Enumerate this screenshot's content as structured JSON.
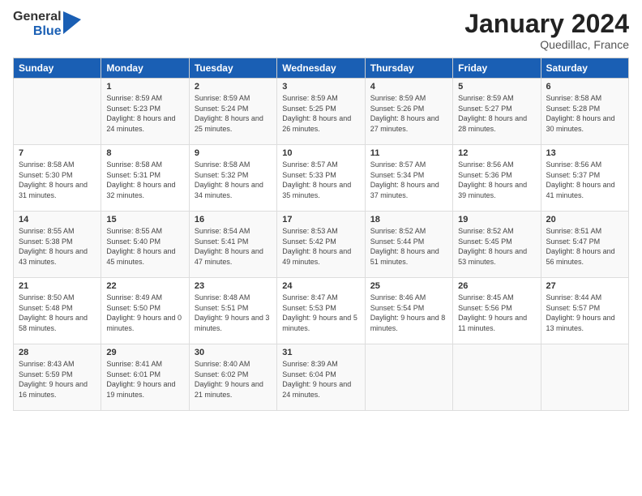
{
  "header": {
    "logo_general": "General",
    "logo_blue": "Blue",
    "month_title": "January 2024",
    "location": "Quedillac, France"
  },
  "days_of_week": [
    "Sunday",
    "Monday",
    "Tuesday",
    "Wednesday",
    "Thursday",
    "Friday",
    "Saturday"
  ],
  "weeks": [
    [
      {
        "day": "",
        "sunrise": "",
        "sunset": "",
        "daylight": ""
      },
      {
        "day": "1",
        "sunrise": "Sunrise: 8:59 AM",
        "sunset": "Sunset: 5:23 PM",
        "daylight": "Daylight: 8 hours and 24 minutes."
      },
      {
        "day": "2",
        "sunrise": "Sunrise: 8:59 AM",
        "sunset": "Sunset: 5:24 PM",
        "daylight": "Daylight: 8 hours and 25 minutes."
      },
      {
        "day": "3",
        "sunrise": "Sunrise: 8:59 AM",
        "sunset": "Sunset: 5:25 PM",
        "daylight": "Daylight: 8 hours and 26 minutes."
      },
      {
        "day": "4",
        "sunrise": "Sunrise: 8:59 AM",
        "sunset": "Sunset: 5:26 PM",
        "daylight": "Daylight: 8 hours and 27 minutes."
      },
      {
        "day": "5",
        "sunrise": "Sunrise: 8:59 AM",
        "sunset": "Sunset: 5:27 PM",
        "daylight": "Daylight: 8 hours and 28 minutes."
      },
      {
        "day": "6",
        "sunrise": "Sunrise: 8:58 AM",
        "sunset": "Sunset: 5:28 PM",
        "daylight": "Daylight: 8 hours and 30 minutes."
      }
    ],
    [
      {
        "day": "7",
        "sunrise": "Sunrise: 8:58 AM",
        "sunset": "Sunset: 5:30 PM",
        "daylight": "Daylight: 8 hours and 31 minutes."
      },
      {
        "day": "8",
        "sunrise": "Sunrise: 8:58 AM",
        "sunset": "Sunset: 5:31 PM",
        "daylight": "Daylight: 8 hours and 32 minutes."
      },
      {
        "day": "9",
        "sunrise": "Sunrise: 8:58 AM",
        "sunset": "Sunset: 5:32 PM",
        "daylight": "Daylight: 8 hours and 34 minutes."
      },
      {
        "day": "10",
        "sunrise": "Sunrise: 8:57 AM",
        "sunset": "Sunset: 5:33 PM",
        "daylight": "Daylight: 8 hours and 35 minutes."
      },
      {
        "day": "11",
        "sunrise": "Sunrise: 8:57 AM",
        "sunset": "Sunset: 5:34 PM",
        "daylight": "Daylight: 8 hours and 37 minutes."
      },
      {
        "day": "12",
        "sunrise": "Sunrise: 8:56 AM",
        "sunset": "Sunset: 5:36 PM",
        "daylight": "Daylight: 8 hours and 39 minutes."
      },
      {
        "day": "13",
        "sunrise": "Sunrise: 8:56 AM",
        "sunset": "Sunset: 5:37 PM",
        "daylight": "Daylight: 8 hours and 41 minutes."
      }
    ],
    [
      {
        "day": "14",
        "sunrise": "Sunrise: 8:55 AM",
        "sunset": "Sunset: 5:38 PM",
        "daylight": "Daylight: 8 hours and 43 minutes."
      },
      {
        "day": "15",
        "sunrise": "Sunrise: 8:55 AM",
        "sunset": "Sunset: 5:40 PM",
        "daylight": "Daylight: 8 hours and 45 minutes."
      },
      {
        "day": "16",
        "sunrise": "Sunrise: 8:54 AM",
        "sunset": "Sunset: 5:41 PM",
        "daylight": "Daylight: 8 hours and 47 minutes."
      },
      {
        "day": "17",
        "sunrise": "Sunrise: 8:53 AM",
        "sunset": "Sunset: 5:42 PM",
        "daylight": "Daylight: 8 hours and 49 minutes."
      },
      {
        "day": "18",
        "sunrise": "Sunrise: 8:52 AM",
        "sunset": "Sunset: 5:44 PM",
        "daylight": "Daylight: 8 hours and 51 minutes."
      },
      {
        "day": "19",
        "sunrise": "Sunrise: 8:52 AM",
        "sunset": "Sunset: 5:45 PM",
        "daylight": "Daylight: 8 hours and 53 minutes."
      },
      {
        "day": "20",
        "sunrise": "Sunrise: 8:51 AM",
        "sunset": "Sunset: 5:47 PM",
        "daylight": "Daylight: 8 hours and 56 minutes."
      }
    ],
    [
      {
        "day": "21",
        "sunrise": "Sunrise: 8:50 AM",
        "sunset": "Sunset: 5:48 PM",
        "daylight": "Daylight: 8 hours and 58 minutes."
      },
      {
        "day": "22",
        "sunrise": "Sunrise: 8:49 AM",
        "sunset": "Sunset: 5:50 PM",
        "daylight": "Daylight: 9 hours and 0 minutes."
      },
      {
        "day": "23",
        "sunrise": "Sunrise: 8:48 AM",
        "sunset": "Sunset: 5:51 PM",
        "daylight": "Daylight: 9 hours and 3 minutes."
      },
      {
        "day": "24",
        "sunrise": "Sunrise: 8:47 AM",
        "sunset": "Sunset: 5:53 PM",
        "daylight": "Daylight: 9 hours and 5 minutes."
      },
      {
        "day": "25",
        "sunrise": "Sunrise: 8:46 AM",
        "sunset": "Sunset: 5:54 PM",
        "daylight": "Daylight: 9 hours and 8 minutes."
      },
      {
        "day": "26",
        "sunrise": "Sunrise: 8:45 AM",
        "sunset": "Sunset: 5:56 PM",
        "daylight": "Daylight: 9 hours and 11 minutes."
      },
      {
        "day": "27",
        "sunrise": "Sunrise: 8:44 AM",
        "sunset": "Sunset: 5:57 PM",
        "daylight": "Daylight: 9 hours and 13 minutes."
      }
    ],
    [
      {
        "day": "28",
        "sunrise": "Sunrise: 8:43 AM",
        "sunset": "Sunset: 5:59 PM",
        "daylight": "Daylight: 9 hours and 16 minutes."
      },
      {
        "day": "29",
        "sunrise": "Sunrise: 8:41 AM",
        "sunset": "Sunset: 6:01 PM",
        "daylight": "Daylight: 9 hours and 19 minutes."
      },
      {
        "day": "30",
        "sunrise": "Sunrise: 8:40 AM",
        "sunset": "Sunset: 6:02 PM",
        "daylight": "Daylight: 9 hours and 21 minutes."
      },
      {
        "day": "31",
        "sunrise": "Sunrise: 8:39 AM",
        "sunset": "Sunset: 6:04 PM",
        "daylight": "Daylight: 9 hours and 24 minutes."
      },
      {
        "day": "",
        "sunrise": "",
        "sunset": "",
        "daylight": ""
      },
      {
        "day": "",
        "sunrise": "",
        "sunset": "",
        "daylight": ""
      },
      {
        "day": "",
        "sunrise": "",
        "sunset": "",
        "daylight": ""
      }
    ]
  ]
}
